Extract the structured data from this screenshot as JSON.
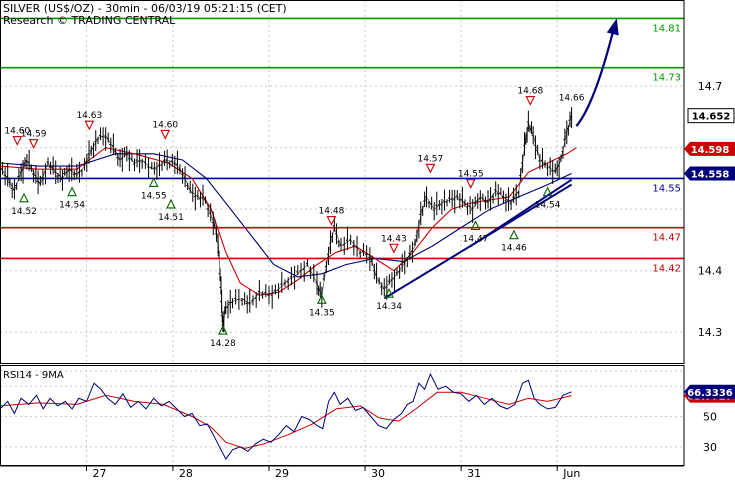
{
  "header": {
    "title": "SILVER (US$/OZ) - 30min - 06/03/19 05:21:15 (CET)",
    "subtitle": "Research © TRADING CENTRAL"
  },
  "colors": {
    "price": "#000000",
    "ma_fast": "#cc0000",
    "ma_slow": "#00007a",
    "resistance": "#cc0000",
    "target": "#009900",
    "pivot": "#00009a",
    "arrow": "#00007a",
    "marker_down": "#cc0000",
    "marker_up": "#006600",
    "grid": "#c8c8c8",
    "axis_label": "#000000"
  },
  "chart_data": [
    {
      "type": "line",
      "name": "price-panel",
      "ylim": [
        14.25,
        14.84
      ],
      "y_ticks": [
        14.3,
        14.4,
        14.5,
        14.6,
        14.7
      ],
      "y_tick_labels": [
        "14.3",
        "14.4",
        "",
        "14.6",
        "14.7"
      ],
      "x_ticks": [
        {
          "x": 0.1,
          "label": "27"
        },
        {
          "x": 1.0,
          "label": "28"
        },
        {
          "x": 2.0,
          "label": "29"
        },
        {
          "x": 3.0,
          "label": "30"
        },
        {
          "x": 4.0,
          "label": "31"
        },
        {
          "x": 5.0,
          "label": "Jun"
        }
      ],
      "x_range": [
        -0.8,
        6.32
      ],
      "current_price": {
        "value": 14.652,
        "label": "14.652"
      },
      "price_tags": [
        {
          "value": 14.598,
          "label": "14.598",
          "color": "#cc0000"
        },
        {
          "value": 14.558,
          "label": "14.558",
          "color": "#00007a"
        }
      ],
      "levels": [
        {
          "value": 14.81,
          "label": "14.81",
          "color": "#009900"
        },
        {
          "value": 14.73,
          "label": "14.73",
          "color": "#009900"
        },
        {
          "value": 14.55,
          "label": "14.55",
          "color": "#00009a"
        },
        {
          "value": 14.47,
          "label": "14.47",
          "color": "#cc0000"
        },
        {
          "value": 14.42,
          "label": "14.42",
          "color": "#cc0000"
        }
      ],
      "trendlines": [
        {
          "x1": 3.2,
          "y1": 14.355,
          "x2": 5.15,
          "y2": 14.54
        },
        {
          "x1": 4.1,
          "y1": 14.44,
          "x2": 5.15,
          "y2": 14.548
        }
      ],
      "forecast_arrow": {
        "x1": 5.2,
        "y1": 14.635,
        "x2": 5.62,
        "y2": 14.81
      },
      "price_path": [
        [
          -0.8,
          14.57
        ],
        [
          -0.72,
          14.55
        ],
        [
          -0.65,
          14.53
        ],
        [
          -0.58,
          14.56
        ],
        [
          -0.52,
          14.58
        ],
        [
          -0.45,
          14.56
        ],
        [
          -0.38,
          14.54
        ],
        [
          -0.3,
          14.575
        ],
        [
          -0.22,
          14.56
        ],
        [
          -0.15,
          14.55
        ],
        [
          -0.08,
          14.565
        ],
        [
          0.0,
          14.555
        ],
        [
          0.08,
          14.57
        ],
        [
          0.15,
          14.595
        ],
        [
          0.22,
          14.615
        ],
        [
          0.3,
          14.62
        ],
        [
          0.38,
          14.6
        ],
        [
          0.45,
          14.58
        ],
        [
          0.52,
          14.59
        ],
        [
          0.6,
          14.575
        ],
        [
          0.68,
          14.58
        ],
        [
          0.78,
          14.565
        ],
        [
          0.86,
          14.57
        ],
        [
          0.94,
          14.58
        ],
        [
          1.02,
          14.575
        ],
        [
          1.1,
          14.56
        ],
        [
          1.18,
          14.53
        ],
        [
          1.26,
          14.52
        ],
        [
          1.34,
          14.515
        ],
        [
          1.42,
          14.48
        ],
        [
          1.47,
          14.45
        ],
        [
          1.5,
          14.37
        ],
        [
          1.52,
          14.31
        ],
        [
          1.55,
          14.34
        ],
        [
          1.62,
          14.35
        ],
        [
          1.72,
          14.355
        ],
        [
          1.8,
          14.345
        ],
        [
          1.9,
          14.365
        ],
        [
          2.0,
          14.36
        ],
        [
          2.1,
          14.37
        ],
        [
          2.2,
          14.385
        ],
        [
          2.3,
          14.395
        ],
        [
          2.4,
          14.41
        ],
        [
          2.5,
          14.38
        ],
        [
          2.55,
          14.36
        ],
        [
          2.62,
          14.43
        ],
        [
          2.68,
          14.47
        ],
        [
          2.75,
          14.44
        ],
        [
          2.85,
          14.45
        ],
        [
          2.95,
          14.43
        ],
        [
          3.05,
          14.425
        ],
        [
          3.12,
          14.39
        ],
        [
          3.2,
          14.37
        ],
        [
          3.28,
          14.385
        ],
        [
          3.36,
          14.4
        ],
        [
          3.44,
          14.42
        ],
        [
          3.52,
          14.44
        ],
        [
          3.58,
          14.49
        ],
        [
          3.64,
          14.52
        ],
        [
          3.72,
          14.5
        ],
        [
          3.8,
          14.51
        ],
        [
          3.88,
          14.515
        ],
        [
          3.96,
          14.52
        ],
        [
          4.04,
          14.51
        ],
        [
          4.12,
          14.5
        ],
        [
          4.2,
          14.52
        ],
        [
          4.28,
          14.51
        ],
        [
          4.36,
          14.53
        ],
        [
          4.44,
          14.52
        ],
        [
          4.52,
          14.51
        ],
        [
          4.6,
          14.53
        ],
        [
          4.66,
          14.6
        ],
        [
          4.7,
          14.64
        ],
        [
          4.75,
          14.62
        ],
        [
          4.82,
          14.58
        ],
        [
          4.9,
          14.57
        ],
        [
          4.98,
          14.56
        ],
        [
          5.04,
          14.58
        ],
        [
          5.1,
          14.625
        ],
        [
          5.15,
          14.652
        ]
      ],
      "ma_fast_path": [
        [
          -0.8,
          14.57
        ],
        [
          -0.4,
          14.565
        ],
        [
          0.0,
          14.565
        ],
        [
          0.3,
          14.6
        ],
        [
          0.6,
          14.59
        ],
        [
          0.95,
          14.575
        ],
        [
          1.2,
          14.55
        ],
        [
          1.4,
          14.5
        ],
        [
          1.55,
          14.43
        ],
        [
          1.7,
          14.38
        ],
        [
          1.9,
          14.36
        ],
        [
          2.1,
          14.365
        ],
        [
          2.3,
          14.385
        ],
        [
          2.5,
          14.41
        ],
        [
          2.7,
          14.43
        ],
        [
          2.9,
          14.44
        ],
        [
          3.1,
          14.42
        ],
        [
          3.3,
          14.4
        ],
        [
          3.5,
          14.43
        ],
        [
          3.7,
          14.47
        ],
        [
          3.9,
          14.5
        ],
        [
          4.1,
          14.51
        ],
        [
          4.3,
          14.515
        ],
        [
          4.5,
          14.52
        ],
        [
          4.7,
          14.56
        ],
        [
          4.9,
          14.575
        ],
        [
          5.1,
          14.59
        ],
        [
          5.2,
          14.6
        ]
      ],
      "ma_slow_path": [
        [
          -0.8,
          14.575
        ],
        [
          -0.4,
          14.57
        ],
        [
          0.0,
          14.57
        ],
        [
          0.4,
          14.59
        ],
        [
          0.8,
          14.59
        ],
        [
          1.1,
          14.58
        ],
        [
          1.35,
          14.55
        ],
        [
          1.6,
          14.5
        ],
        [
          1.85,
          14.45
        ],
        [
          2.05,
          14.41
        ],
        [
          2.3,
          14.39
        ],
        [
          2.55,
          14.395
        ],
        [
          2.8,
          14.41
        ],
        [
          3.1,
          14.42
        ],
        [
          3.4,
          14.415
        ],
        [
          3.7,
          14.44
        ],
        [
          4.0,
          14.47
        ],
        [
          4.3,
          14.5
        ],
        [
          4.6,
          14.52
        ],
        [
          4.9,
          14.54
        ],
        [
          5.15,
          14.558
        ]
      ],
      "swing_labels": [
        {
          "x": -0.62,
          "y": 14.605,
          "label": "14.60",
          "dir": "down"
        },
        {
          "x": -0.45,
          "y": 14.6,
          "label": "14.59",
          "dir": "down"
        },
        {
          "x": -0.55,
          "y": 14.525,
          "label": "14.52",
          "dir": "up"
        },
        {
          "x": -0.05,
          "y": 14.535,
          "label": "14.54",
          "dir": "up"
        },
        {
          "x": 0.13,
          "y": 14.63,
          "label": "14.63",
          "dir": "down"
        },
        {
          "x": 0.8,
          "y": 14.55,
          "label": "14.55",
          "dir": "up"
        },
        {
          "x": 0.92,
          "y": 14.615,
          "label": "14.60",
          "dir": "down"
        },
        {
          "x": 0.98,
          "y": 14.515,
          "label": "14.51",
          "dir": "up"
        },
        {
          "x": 1.52,
          "y": 14.31,
          "label": "14.28",
          "dir": "up"
        },
        {
          "x": 2.55,
          "y": 14.36,
          "label": "14.35",
          "dir": "up"
        },
        {
          "x": 2.65,
          "y": 14.475,
          "label": "14.48",
          "dir": "down"
        },
        {
          "x": 3.25,
          "y": 14.37,
          "label": "14.34",
          "dir": "up"
        },
        {
          "x": 3.3,
          "y": 14.43,
          "label": "14.43",
          "dir": "down"
        },
        {
          "x": 3.68,
          "y": 14.56,
          "label": "14.57",
          "dir": "down"
        },
        {
          "x": 4.1,
          "y": 14.535,
          "label": "14.55",
          "dir": "down"
        },
        {
          "x": 4.15,
          "y": 14.48,
          "label": "14.47",
          "dir": "up"
        },
        {
          "x": 4.55,
          "y": 14.465,
          "label": "14.46",
          "dir": "up"
        },
        {
          "x": 4.72,
          "y": 14.67,
          "label": "14.68",
          "dir": "down"
        },
        {
          "x": 5.15,
          "y": 14.67,
          "label": "14.66",
          "dir": "none"
        },
        {
          "x": 4.9,
          "y": 14.535,
          "label": "14.54",
          "dir": "up"
        }
      ]
    },
    {
      "type": "line",
      "name": "rsi-panel",
      "title": "RSI14 - 9MA",
      "ylim": [
        18,
        84
      ],
      "y_ticks": [
        30,
        50
      ],
      "y_tick_labels": [
        "30",
        "50"
      ],
      "grid_values": [
        30,
        50,
        70,
        80
      ],
      "rsi_value": {
        "value": 66.3336,
        "label": "66.3336"
      },
      "ma_value": {
        "value": 63.7727,
        "label": "63.7727"
      },
      "rsi_path": [
        [
          -0.8,
          55
        ],
        [
          -0.72,
          60
        ],
        [
          -0.65,
          52
        ],
        [
          -0.58,
          62
        ],
        [
          -0.5,
          58
        ],
        [
          -0.42,
          64
        ],
        [
          -0.35,
          55
        ],
        [
          -0.28,
          62
        ],
        [
          -0.2,
          57
        ],
        [
          -0.12,
          60
        ],
        [
          -0.05,
          55
        ],
        [
          0.02,
          62
        ],
        [
          0.1,
          60
        ],
        [
          0.18,
          72
        ],
        [
          0.25,
          68
        ],
        [
          0.32,
          62
        ],
        [
          0.4,
          58
        ],
        [
          0.48,
          65
        ],
        [
          0.56,
          56
        ],
        [
          0.64,
          60
        ],
        [
          0.72,
          55
        ],
        [
          0.8,
          62
        ],
        [
          0.88,
          57
        ],
        [
          0.96,
          60
        ],
        [
          1.04,
          55
        ],
        [
          1.12,
          50
        ],
        [
          1.2,
          52
        ],
        [
          1.28,
          44
        ],
        [
          1.36,
          45
        ],
        [
          1.42,
          38
        ],
        [
          1.5,
          28
        ],
        [
          1.55,
          22
        ],
        [
          1.62,
          28
        ],
        [
          1.7,
          30
        ],
        [
          1.78,
          27
        ],
        [
          1.86,
          32
        ],
        [
          1.94,
          35
        ],
        [
          2.02,
          33
        ],
        [
          2.1,
          38
        ],
        [
          2.18,
          44
        ],
        [
          2.26,
          40
        ],
        [
          2.34,
          50
        ],
        [
          2.42,
          48
        ],
        [
          2.5,
          44
        ],
        [
          2.56,
          42
        ],
        [
          2.62,
          60
        ],
        [
          2.68,
          66
        ],
        [
          2.74,
          58
        ],
        [
          2.82,
          62
        ],
        [
          2.9,
          54
        ],
        [
          2.98,
          56
        ],
        [
          3.06,
          50
        ],
        [
          3.14,
          44
        ],
        [
          3.22,
          42
        ],
        [
          3.3,
          48
        ],
        [
          3.38,
          52
        ],
        [
          3.44,
          58
        ],
        [
          3.5,
          60
        ],
        [
          3.56,
          72
        ],
        [
          3.62,
          68
        ],
        [
          3.68,
          78
        ],
        [
          3.76,
          68
        ],
        [
          3.84,
          70
        ],
        [
          3.92,
          66
        ],
        [
          4.0,
          65
        ],
        [
          4.08,
          60
        ],
        [
          4.16,
          64
        ],
        [
          4.24,
          58
        ],
        [
          4.32,
          62
        ],
        [
          4.4,
          57
        ],
        [
          4.48,
          55
        ],
        [
          4.56,
          58
        ],
        [
          4.64,
          72
        ],
        [
          4.7,
          74
        ],
        [
          4.76,
          62
        ],
        [
          4.82,
          58
        ],
        [
          4.9,
          55
        ],
        [
          4.98,
          56
        ],
        [
          5.06,
          64
        ],
        [
          5.15,
          66.3
        ]
      ],
      "ma_path": [
        [
          -0.8,
          57
        ],
        [
          -0.4,
          59
        ],
        [
          0.0,
          58
        ],
        [
          0.3,
          64
        ],
        [
          0.6,
          60
        ],
        [
          0.9,
          58
        ],
        [
          1.2,
          50
        ],
        [
          1.4,
          43
        ],
        [
          1.55,
          33
        ],
        [
          1.75,
          29
        ],
        [
          1.95,
          32
        ],
        [
          2.2,
          38
        ],
        [
          2.45,
          45
        ],
        [
          2.7,
          55
        ],
        [
          2.95,
          57
        ],
        [
          3.15,
          49
        ],
        [
          3.35,
          47
        ],
        [
          3.55,
          56
        ],
        [
          3.75,
          66
        ],
        [
          4.0,
          66
        ],
        [
          4.25,
          62
        ],
        [
          4.5,
          58
        ],
        [
          4.7,
          62
        ],
        [
          4.9,
          60
        ],
        [
          5.15,
          63.8
        ]
      ]
    }
  ]
}
